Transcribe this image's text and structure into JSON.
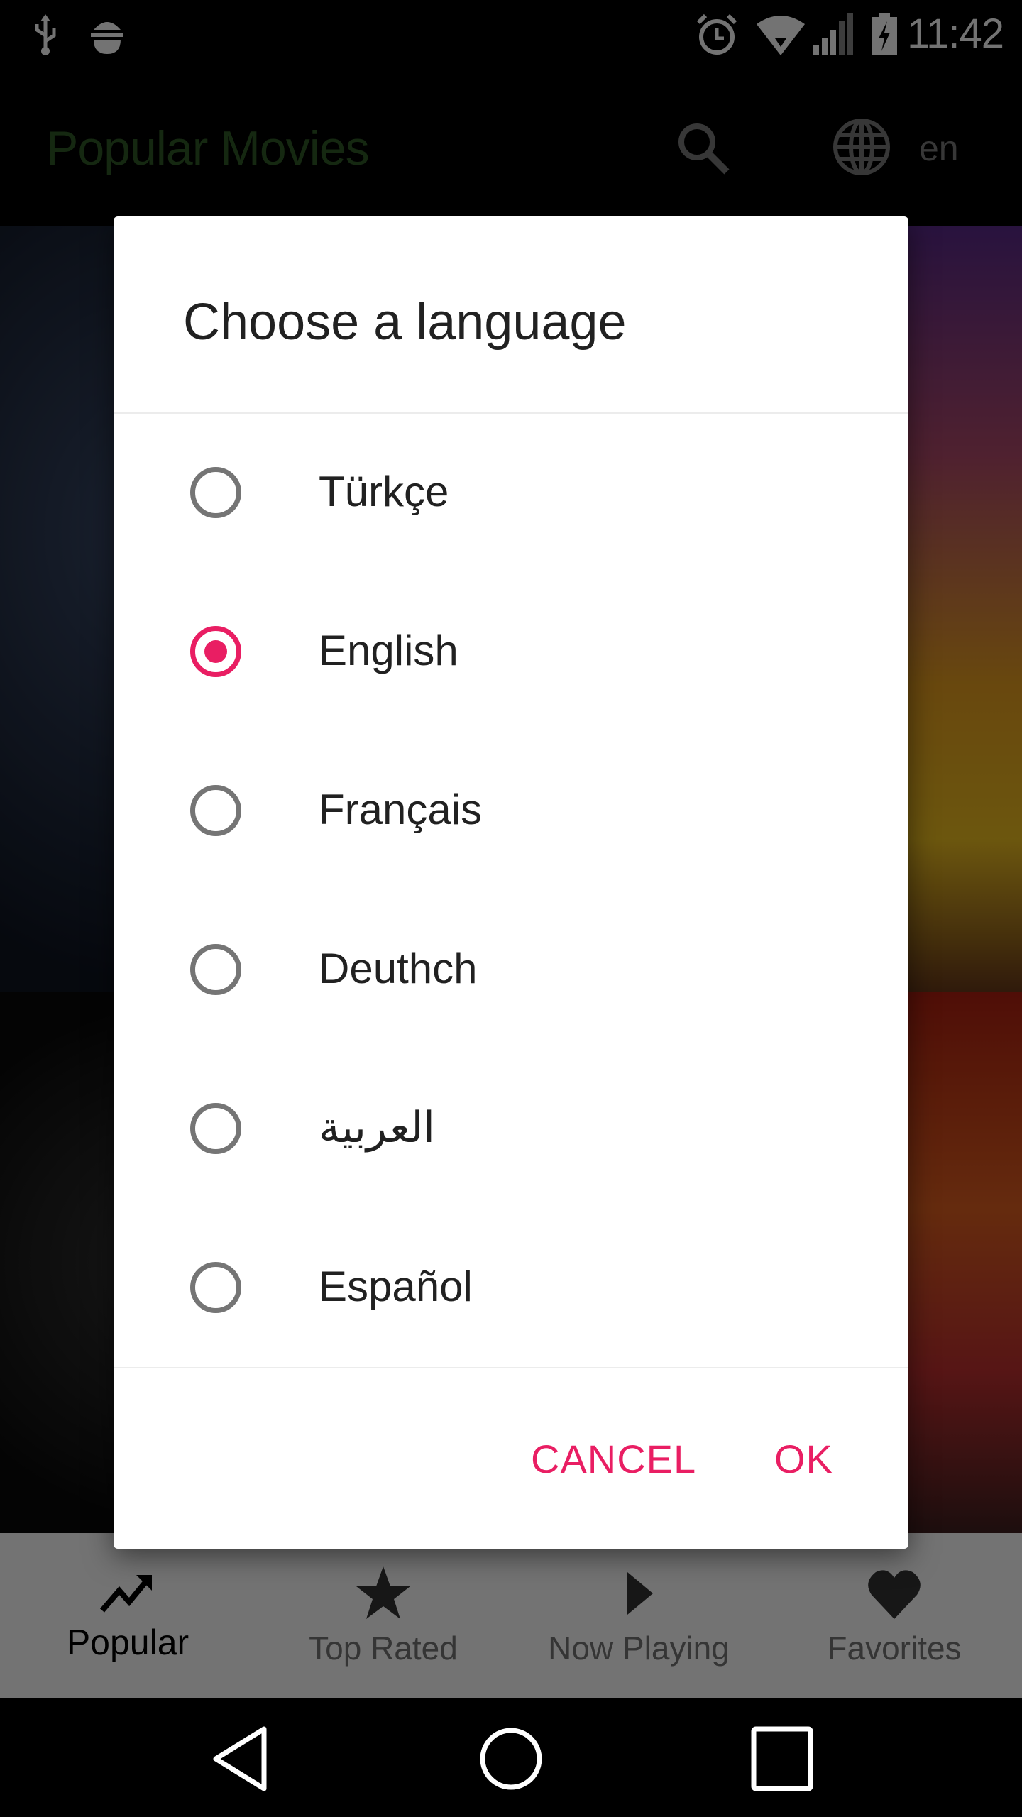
{
  "status_bar": {
    "time": "11:42",
    "icons": [
      "usb-icon",
      "android-debug-icon",
      "alarm-icon",
      "wifi-icon",
      "signal-icon",
      "battery-charging-icon"
    ]
  },
  "app_bar": {
    "title": "Popular Movies",
    "language_code": "en",
    "icons": [
      "search-icon",
      "globe-icon"
    ]
  },
  "dialog": {
    "title": "Choose a language",
    "options": [
      {
        "label": "Türkçe",
        "selected": false
      },
      {
        "label": "English",
        "selected": true
      },
      {
        "label": "Français",
        "selected": false
      },
      {
        "label": "Deuthch",
        "selected": false
      },
      {
        "label": "العربية",
        "selected": false
      },
      {
        "label": "Español",
        "selected": false
      }
    ],
    "cancel_label": "CANCEL",
    "ok_label": "OK",
    "accent_color": "#e91e63"
  },
  "bottom_nav": {
    "items": [
      {
        "label": "Popular",
        "icon": "trending-up-icon",
        "active": true
      },
      {
        "label": "Top Rated",
        "icon": "star-icon",
        "active": false
      },
      {
        "label": "Now Playing",
        "icon": "play-icon",
        "active": false
      },
      {
        "label": "Favorites",
        "icon": "heart-icon",
        "active": false
      }
    ]
  },
  "system_nav": {
    "icons": [
      "back-icon",
      "home-icon",
      "recents-icon"
    ]
  }
}
